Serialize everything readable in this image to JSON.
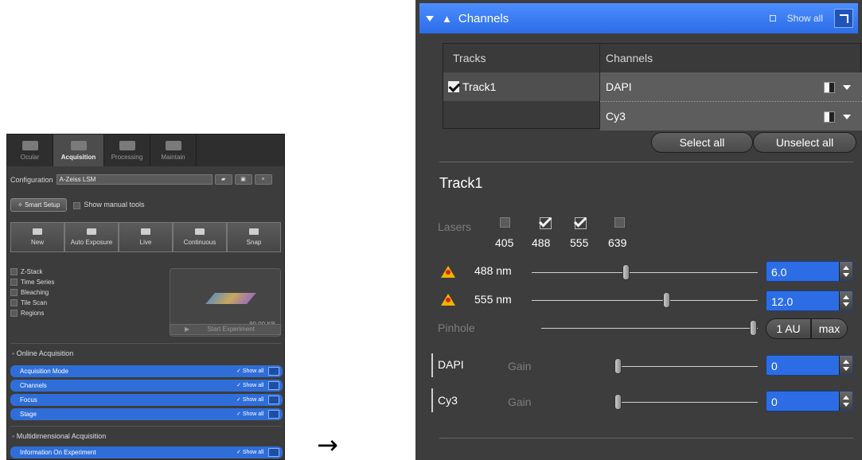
{
  "left_panel": {
    "tabs": [
      {
        "label": "Ocular",
        "icon": "ocular-icon"
      },
      {
        "label": "Acquisition",
        "icon": "acquisition-icon"
      },
      {
        "label": "Processing",
        "icon": "processing-icon"
      },
      {
        "label": "Maintain",
        "icon": "maintain-icon"
      }
    ],
    "config_label": "Configuration",
    "config_value": "A-Zeiss LSM",
    "smart_setup": "Smart Setup",
    "show_manual_tools": "Show manual tools",
    "acq_buttons": [
      "New",
      "Auto Exposure",
      "Live",
      "Continuous",
      "Snap"
    ],
    "checks": [
      "Z-Stack",
      "Time Series",
      "Bleaching",
      "Tile Scan",
      "Regions"
    ],
    "preview_size": "80.00 KB",
    "start_experiment": "Start Experiment",
    "online_title": "Online Acquisition",
    "online_items": [
      "Acquisition Mode",
      "Channels",
      "Focus",
      "Stage"
    ],
    "show_all": "Show all",
    "multi_title": "Multidimensional Acquisition",
    "multi_items": [
      "Information On Experiment"
    ]
  },
  "arrow": "→",
  "channels_panel": {
    "title": "Channels",
    "show_all": "Show all",
    "tracks_header": "Tracks",
    "channels_header": "Channels",
    "track_name": "Track1",
    "channels": [
      "DAPI",
      "Cy3"
    ],
    "select_all": "Select all",
    "unselect_all": "Unselect all",
    "track_title": "Track1",
    "lasers_label": "Lasers",
    "lasers": [
      {
        "wavelength": "405",
        "checked": false
      },
      {
        "wavelength": "488",
        "checked": true
      },
      {
        "wavelength": "555",
        "checked": true
      },
      {
        "wavelength": "639",
        "checked": false
      }
    ],
    "laser_rows": [
      {
        "label": "488 nm",
        "value": "6.0",
        "slider_fraction": 0.42
      },
      {
        "label": "555 nm",
        "value": "12.0",
        "slider_fraction": 0.6
      }
    ],
    "pinhole_label": "Pinhole",
    "pinhole_unit": "1 AU",
    "pinhole_max": "max",
    "detector_rows": [
      {
        "channel": "DAPI",
        "gain_label": "Gain",
        "value": "0"
      },
      {
        "channel": "Cy3",
        "gain_label": "Gain",
        "value": "0"
      }
    ],
    "accent": "#2c6de6"
  }
}
